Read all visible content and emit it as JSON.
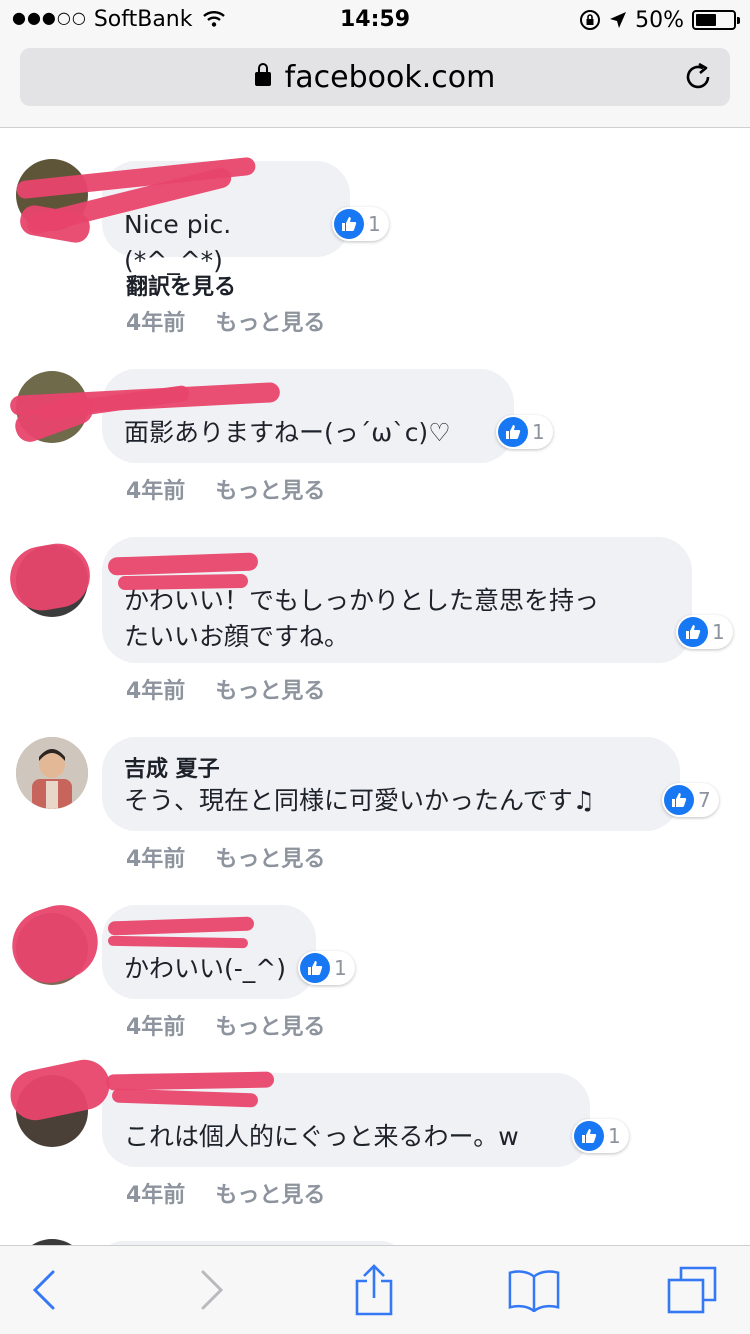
{
  "status_bar": {
    "signal": "●●●○○",
    "carrier": "SoftBank",
    "time": "14:59",
    "battery": "50%"
  },
  "browser": {
    "url": "facebook.com"
  },
  "comments": [
    {
      "author": "",
      "text": "Nice pic. (*^_^*)",
      "likes": "1",
      "translate": "翻訳を見る",
      "time": "4年前",
      "more": "もっと見る"
    },
    {
      "author": "",
      "text": "面影ありますねー(っ´ω`c)♡",
      "likes": "1",
      "time": "4年前",
      "more": "もっと見る"
    },
    {
      "author": "",
      "text": "かわいい！でもしっかりとした意思を持っ\nたいいお顔ですね。",
      "likes": "1",
      "time": "4年前",
      "more": "もっと見る"
    },
    {
      "author": "吉成 夏子",
      "text": "そう、現在と同様に可愛いかったんです♫",
      "likes": "7",
      "time": "4年前",
      "more": "もっと見る"
    },
    {
      "author": "",
      "text": "かわいい(-_^)",
      "likes": "1",
      "time": "4年前",
      "more": "もっと見る"
    },
    {
      "author": "",
      "text": "これは個人的にぐっと来るわー。w",
      "likes": "1",
      "time": "4年前",
      "more": "もっと見る"
    }
  ],
  "colors": {
    "like_blue": "#1877f2",
    "bubble_bg": "#f0f1f5",
    "meta_gray": "#8d949e",
    "redaction": "#e8446b",
    "ios_blue": "#3478f6"
  },
  "icons": {
    "back": "chevron-left-icon",
    "forward": "chevron-right-icon",
    "share": "share-icon",
    "bookmarks": "book-icon",
    "tabs": "tabs-icon"
  }
}
